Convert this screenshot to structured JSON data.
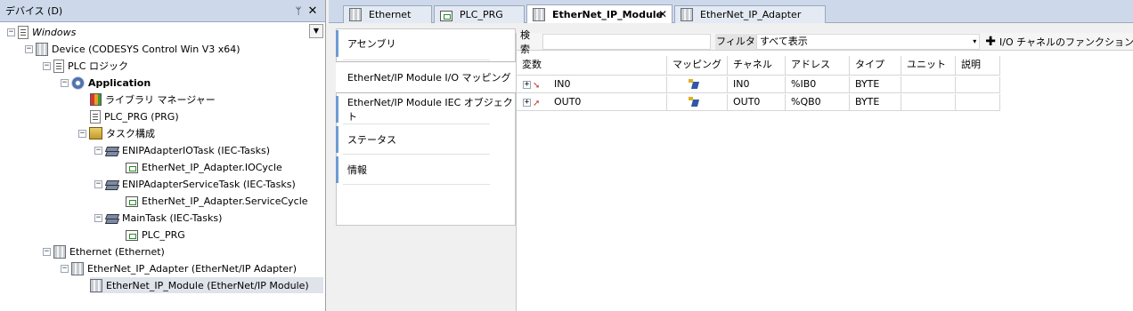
{
  "left_panel": {
    "title": "デバイス (D)",
    "pin": "ᛘ",
    "menu": "▼",
    "close": "✕"
  },
  "tree": [
    {
      "label": "Windows",
      "icon": "windows-project-icon",
      "expander": "−"
    },
    {
      "label": "Device (CODESYS Control Win V3 x64)",
      "icon": "device-icon",
      "expander": "−"
    },
    {
      "label": "PLC ロジック",
      "icon": "plc-logic-icon",
      "expander": "−"
    },
    {
      "label": "Application",
      "icon": "application-gear-icon",
      "expander": "−"
    },
    {
      "label": "ライブラリ マネージャー",
      "icon": "library-manager-icon",
      "expander": ""
    },
    {
      "label": "PLC_PRG (PRG)",
      "icon": "program-doc-icon",
      "expander": ""
    },
    {
      "label": "タスク構成",
      "icon": "task-configuration-icon",
      "expander": "−"
    },
    {
      "label": "ENIPAdapterIOTask (IEC-Tasks)",
      "icon": "task-stack-icon",
      "expander": "−"
    },
    {
      "label": "EtherNet_IP_Adapter.IOCycle",
      "icon": "program-call-icon",
      "expander": ""
    },
    {
      "label": "ENIPAdapterServiceTask (IEC-Tasks)",
      "icon": "task-stack-icon",
      "expander": "−"
    },
    {
      "label": "EtherNet_IP_Adapter.ServiceCycle",
      "icon": "program-call-icon",
      "expander": ""
    },
    {
      "label": "MainTask (IEC-Tasks)",
      "icon": "task-stack-icon",
      "expander": "−"
    },
    {
      "label": "PLC_PRG",
      "icon": "program-call-icon",
      "expander": ""
    },
    {
      "label": "Ethernet (Ethernet)",
      "icon": "device-icon",
      "expander": "−"
    },
    {
      "label": "EtherNet_IP_Adapter (EtherNet/IP Adapter)",
      "icon": "device-icon",
      "expander": "−"
    },
    {
      "label": "EtherNet_IP_Module (EtherNet/IP Module)",
      "icon": "device-icon",
      "expander": ""
    }
  ],
  "doc_tabs": [
    {
      "label": "Ethernet"
    },
    {
      "label": "PLC_PRG"
    },
    {
      "label": "EtherNet_IP_Module",
      "close": "✕"
    },
    {
      "label": "EtherNet_IP_Adapter"
    }
  ],
  "side_tabs": [
    {
      "label": "アセンブリ"
    },
    {
      "label": "EtherNet/IP Module I/O マッピング"
    },
    {
      "label": "EtherNet/IP Module IEC オブジェクト"
    },
    {
      "label": "ステータス"
    },
    {
      "label": "情報"
    }
  ],
  "toolbar": {
    "search_label": "検索",
    "search_value": "",
    "filter_label": "フィルター",
    "filter_value": "すべて表示",
    "filter_caret": "▾",
    "add_function_label": "I/O チャネルのファンクション"
  },
  "grid": {
    "headers": [
      "変数",
      "マッピング",
      "チャネル",
      "アドレス",
      "タイプ",
      "ユニット",
      "説明"
    ],
    "rows": [
      {
        "variable": "IN0",
        "channel": "IN0",
        "address": "%IB0",
        "type": "BYTE",
        "unit": "",
        "description": ""
      },
      {
        "variable": "OUT0",
        "channel": "OUT0",
        "address": "%QB0",
        "type": "BYTE",
        "unit": "",
        "description": ""
      }
    ]
  }
}
